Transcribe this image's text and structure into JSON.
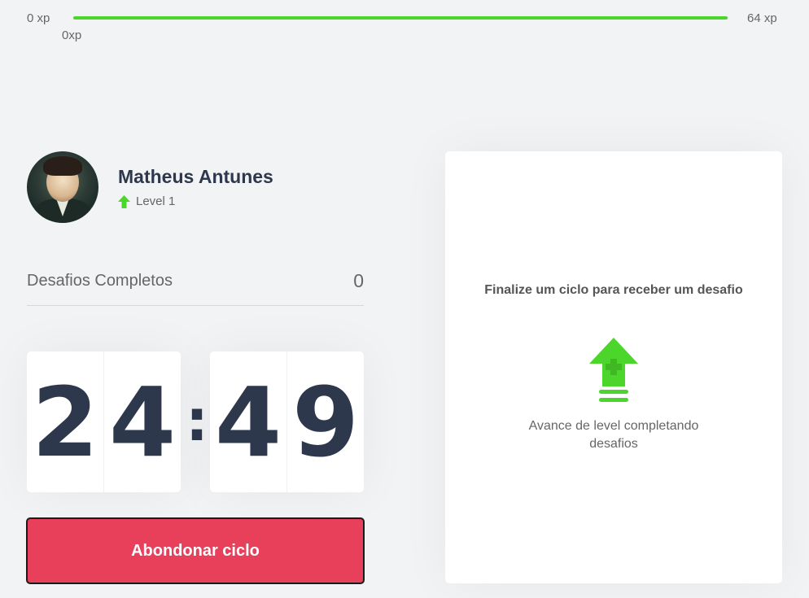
{
  "xp": {
    "min_label": "0 xp",
    "max_label": "64 xp",
    "current_label": "0xp",
    "progress_percent": 100,
    "bar_color": "#4cd62b"
  },
  "profile": {
    "name": "Matheus Antunes",
    "level_label": "Level 1",
    "level_icon": "level-up-arrow-icon",
    "level_icon_color": "#4cd62b"
  },
  "challenges": {
    "label": "Desafios Completos",
    "count": "0"
  },
  "countdown": {
    "minute_left": "2",
    "minute_right": "4",
    "separator": ":",
    "second_left": "4",
    "second_right": "9"
  },
  "cycle_button": {
    "label": "Abondonar ciclo",
    "color": "#e83f5b"
  },
  "challenge_box": {
    "headline": "Finalize um ciclo para receber um desafio",
    "icon": "level-up-icon",
    "hint": "Avance de level completando desafios"
  }
}
